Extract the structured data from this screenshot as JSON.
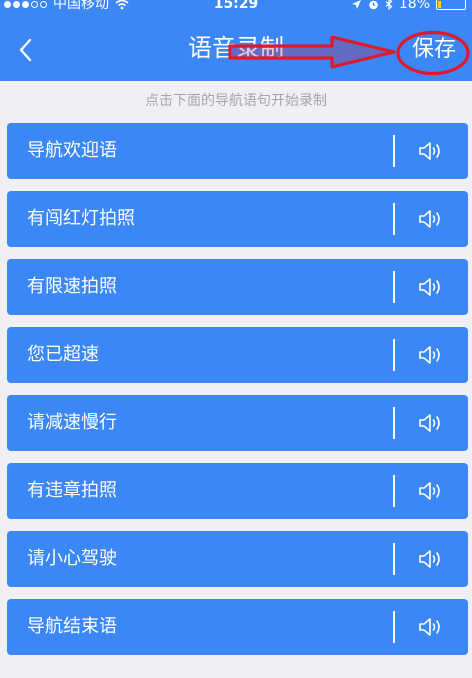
{
  "status_bar": {
    "carrier": "中国移动",
    "time": "15:29",
    "battery_percent": "18%",
    "battery_level": 0.18,
    "icons": [
      "signal-dots-icon",
      "wifi-icon",
      "location-icon",
      "alarm-icon",
      "bluetooth-icon",
      "battery-icon"
    ]
  },
  "nav": {
    "back_icon": "chevron-left-icon",
    "title": "语音录制",
    "save_label": "保存"
  },
  "annotations": {
    "arrow_color": "#e0182a",
    "circle_color": "#e0182a"
  },
  "hint": "点击下面的导航语句开始录制",
  "items": [
    {
      "label": "导航欢迎语"
    },
    {
      "label": "有闯红灯拍照"
    },
    {
      "label": "有限速拍照"
    },
    {
      "label": "您已超速"
    },
    {
      "label": "请减速慢行"
    },
    {
      "label": "有违章拍照"
    },
    {
      "label": "请小心驾驶"
    },
    {
      "label": "导航结束语"
    }
  ],
  "item_icon": "speaker-icon",
  "colors": {
    "primary": "#3b87f5",
    "background": "#efeff4",
    "hint_text": "#a6a6aa",
    "battery": "#ffd400"
  }
}
